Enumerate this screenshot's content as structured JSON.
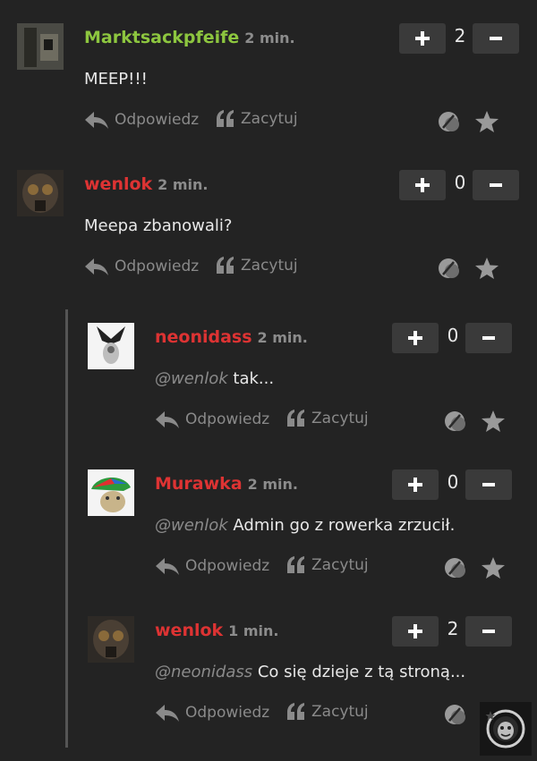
{
  "colors": {
    "author_green": "#8dc63f",
    "author_red": "#dd3333"
  },
  "actions": {
    "reply_label": "Odpowiedz",
    "quote_label": "Zacytuj"
  },
  "comments": [
    {
      "author": "Marktsackpfeife",
      "time": "2 min.",
      "score": "2",
      "mention": "",
      "text": "MEEP!!!"
    },
    {
      "author": "wenlok",
      "time": "2 min.",
      "score": "0",
      "mention": "",
      "text": "Meepa zbanowali?"
    },
    {
      "author": "neonidass",
      "time": "2 min.",
      "score": "0",
      "mention": "@wenlok",
      "text": "tak..."
    },
    {
      "author": "Murawka",
      "time": "2 min.",
      "score": "0",
      "mention": "@wenlok",
      "text": "Admin go z rowerka zrzucił."
    },
    {
      "author": "wenlok",
      "time": "1 min.",
      "score": "2",
      "mention": "@neonidass",
      "text": "Co się dzieje z tą stroną..."
    }
  ]
}
